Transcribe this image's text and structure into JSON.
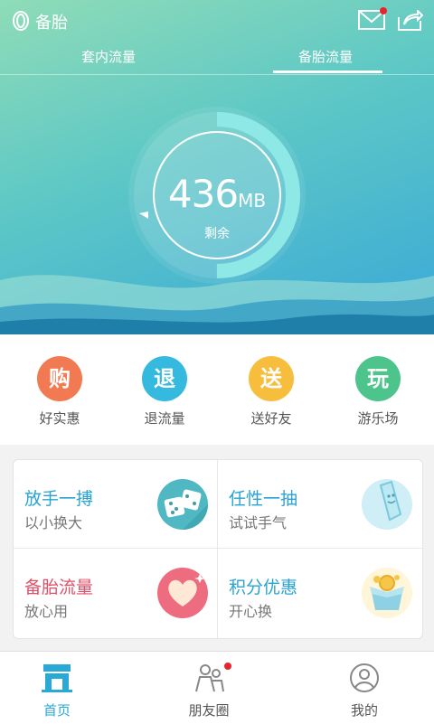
{
  "app": {
    "title": "备胎"
  },
  "tabs": [
    {
      "label": "套内流量",
      "active": false
    },
    {
      "label": "备胎流量",
      "active": true
    }
  ],
  "meter": {
    "value": "436",
    "unit": "MB",
    "caption": "剩余",
    "fill_fraction": 0.5
  },
  "quick_actions": [
    {
      "glyph": "购",
      "label": "好实惠",
      "color": "#f27a52",
      "icon": "shop-icon"
    },
    {
      "glyph": "退",
      "label": "退流量",
      "color": "#35b9df",
      "icon": "refund-icon"
    },
    {
      "glyph": "送",
      "label": "送好友",
      "color": "#f7bd3d",
      "icon": "gift-icon"
    },
    {
      "glyph": "玩",
      "label": "游乐场",
      "color": "#4cc48b",
      "icon": "play-icon"
    }
  ],
  "cards": [
    {
      "title": "放手一搏",
      "subtitle": "以小换大",
      "title_color": "#2aa3d4",
      "icon": "dice-icon"
    },
    {
      "title": "任性一抽",
      "subtitle": "试试手气",
      "title_color": "#2aa3d4",
      "icon": "lottery-stick-icon"
    },
    {
      "title": "备胎流量",
      "subtitle": "放心用",
      "title_color": "#e0506a",
      "icon": "heart-icon"
    },
    {
      "title": "积分优惠",
      "subtitle": "开心换",
      "title_color": "#2aa3d4",
      "icon": "coin-box-icon"
    }
  ],
  "bottom_nav": [
    {
      "label": "首页",
      "active": true,
      "icon": "store-icon"
    },
    {
      "label": "朋友圈",
      "active": false,
      "icon": "friends-icon",
      "badge": true
    },
    {
      "label": "我的",
      "active": false,
      "icon": "profile-icon"
    }
  ],
  "colors": {
    "accent": "#2aa8d6",
    "badge": "#e8232d"
  }
}
